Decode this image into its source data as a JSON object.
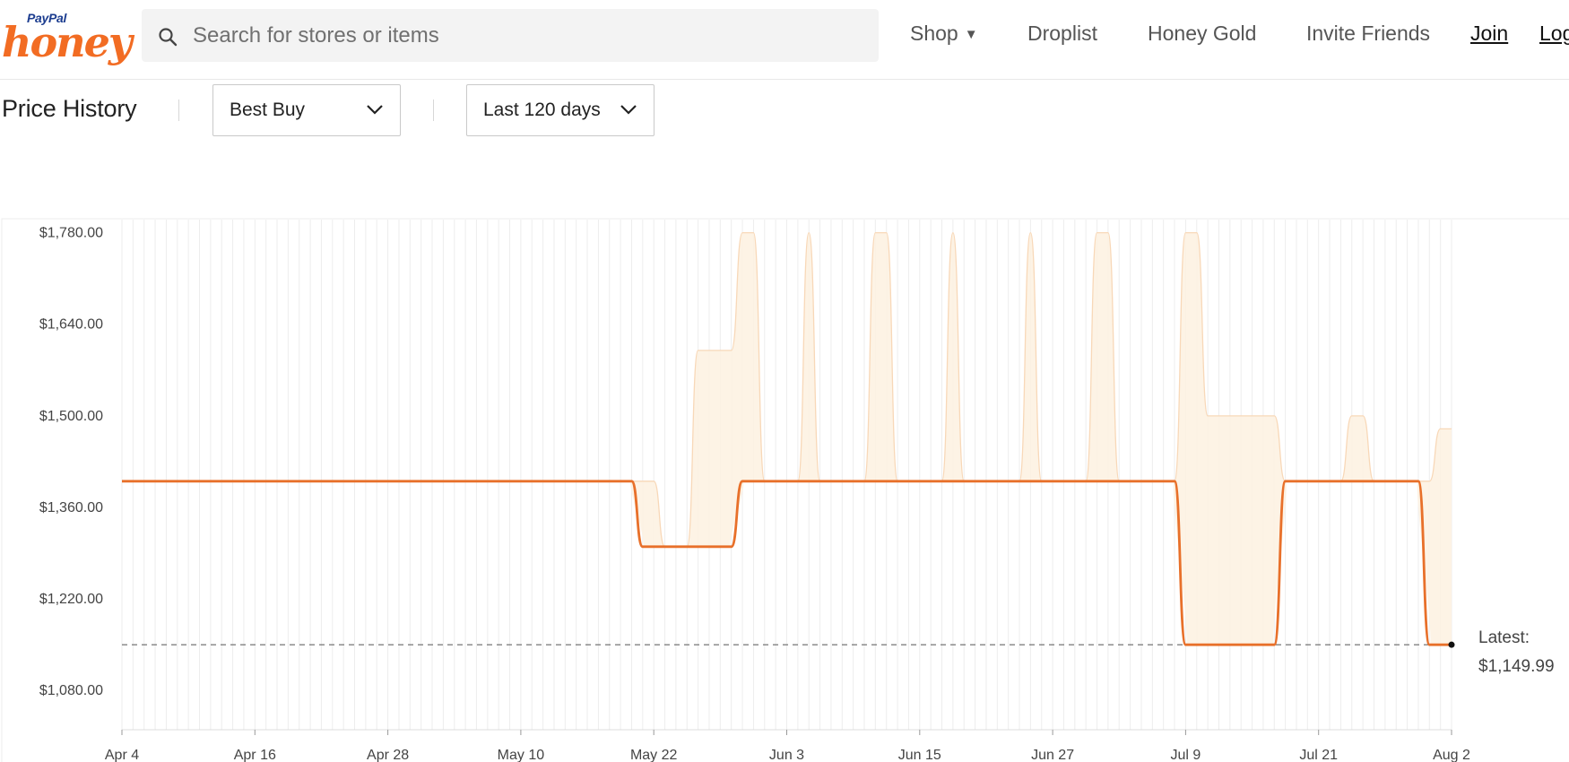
{
  "header": {
    "logo_top": "PayPal",
    "logo_main": "honey",
    "search_placeholder": "Search for stores or items",
    "nav": {
      "shop": "Shop",
      "droplist": "Droplist",
      "honey_gold": "Honey Gold",
      "invite": "Invite Friends",
      "join": "Join",
      "login": "Log"
    }
  },
  "controls": {
    "title": "Price History",
    "store": "Best Buy",
    "range": "Last 120 days"
  },
  "colors": {
    "primary_line": "#e8702a",
    "range_fill": "#fdf1e0",
    "range_edge": "#f8d8b8",
    "brand": "#f26c23"
  },
  "chart_data": {
    "type": "line",
    "ylim": [
      1020,
      1800
    ],
    "y_ticks": [
      {
        "value": 1780,
        "label": "$1,780.00"
      },
      {
        "value": 1640,
        "label": "$1,640.00"
      },
      {
        "value": 1500,
        "label": "$1,500.00"
      },
      {
        "value": 1360,
        "label": "$1,360.00"
      },
      {
        "value": 1220,
        "label": "$1,220.00"
      },
      {
        "value": 1080,
        "label": "$1,080.00"
      }
    ],
    "x_range": [
      0,
      120
    ],
    "x_ticks": [
      {
        "day": 0,
        "label": "Apr 4"
      },
      {
        "day": 12,
        "label": "Apr 16"
      },
      {
        "day": 24,
        "label": "Apr 28"
      },
      {
        "day": 36,
        "label": "May 10"
      },
      {
        "day": 48,
        "label": "May 22"
      },
      {
        "day": 60,
        "label": "Jun 3"
      },
      {
        "day": 72,
        "label": "Jun 15"
      },
      {
        "day": 84,
        "label": "Jun 27"
      },
      {
        "day": 96,
        "label": "Jul 9"
      },
      {
        "day": 108,
        "label": "Jul 21"
      },
      {
        "day": 120,
        "label": "Aug 2"
      }
    ],
    "price": [
      [
        0,
        1399.99
      ],
      [
        46,
        1399.99
      ],
      [
        47,
        1299.99
      ],
      [
        55,
        1299.99
      ],
      [
        56,
        1399.99
      ],
      [
        95,
        1399.99
      ],
      [
        96,
        1149.99
      ],
      [
        104,
        1149.99
      ],
      [
        105,
        1399.99
      ],
      [
        117,
        1399.99
      ],
      [
        118,
        1149.99
      ],
      [
        120,
        1149.99
      ]
    ],
    "range_upper": [
      [
        0,
        1399.99
      ],
      [
        46,
        1399.99
      ],
      [
        48,
        1399.99
      ],
      [
        49,
        1299.99
      ],
      [
        51,
        1299.99
      ],
      [
        52,
        1599.99
      ],
      [
        55,
        1599.99
      ],
      [
        56,
        1779.99
      ],
      [
        57,
        1779.99
      ],
      [
        58,
        1399.99
      ],
      [
        61,
        1399.99
      ],
      [
        62,
        1779.99
      ],
      [
        63,
        1399.99
      ],
      [
        67,
        1399.99
      ],
      [
        68,
        1779.99
      ],
      [
        69,
        1779.99
      ],
      [
        70,
        1399.99
      ],
      [
        74,
        1399.99
      ],
      [
        75,
        1779.99
      ],
      [
        76,
        1399.99
      ],
      [
        81,
        1399.99
      ],
      [
        82,
        1779.99
      ],
      [
        83,
        1399.99
      ],
      [
        87,
        1399.99
      ],
      [
        88,
        1779.99
      ],
      [
        89,
        1779.99
      ],
      [
        90,
        1399.99
      ],
      [
        95,
        1399.99
      ],
      [
        96,
        1779.99
      ],
      [
        97,
        1779.99
      ],
      [
        98,
        1499.99
      ],
      [
        104,
        1499.99
      ],
      [
        105,
        1399.99
      ],
      [
        110,
        1399.99
      ],
      [
        111,
        1499.99
      ],
      [
        112,
        1499.99
      ],
      [
        113,
        1399.99
      ],
      [
        118,
        1399.99
      ],
      [
        119,
        1479.99
      ],
      [
        120,
        1479.99
      ]
    ],
    "latest": {
      "day": 120,
      "value": 1149.99,
      "label": "Latest:",
      "price_label": "$1,149.99"
    }
  }
}
